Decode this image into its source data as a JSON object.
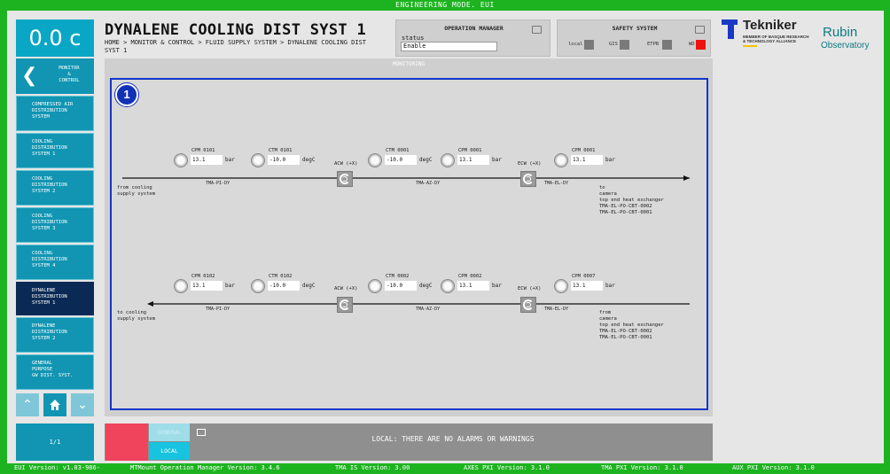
{
  "window": {
    "mode_title": "ENGINEERING MODE. EUI"
  },
  "sidebar": {
    "temperature": "0.0 c",
    "back": {
      "label": "MONITOR\n&\nCONTROL"
    },
    "items": [
      {
        "label": "COMPRESSED AIR\nDISTRIBUTION\nSYSTEM",
        "active": false
      },
      {
        "label": "COOLING\nDISTRIBUTION\nSYSTEM 1",
        "active": false
      },
      {
        "label": "COOLING\nDISTRIBUTION\nSYSTEM 2",
        "active": false
      },
      {
        "label": "COOLING\nDISTRIBUTION\nSYSTEM 3",
        "active": false
      },
      {
        "label": "COOLING\nDISTRIBUTION\nSYSTEM 4",
        "active": false
      },
      {
        "label": "DYNALENE\nDISTRIBUTION\nSYSTEM 1",
        "active": true
      },
      {
        "label": "DYNALENE\nDISTRIBUTION\nSYSTEM 2",
        "active": false
      },
      {
        "label": "GENERAL\nPURPOSE\nGW DIST. SYST.",
        "active": false
      }
    ],
    "pager": "1/1"
  },
  "header": {
    "title": "DYNALENE COOLING DIST SYST 1",
    "breadcrumb": "HOME > MONITOR & CONTROL > FLUID SUPPLY SYSTEM > DYNALENE COOLING DIST SYST 1"
  },
  "operation_manager": {
    "title": "OPERATION MANAGER",
    "status_label": "status",
    "status_value": "Enable"
  },
  "safety_system": {
    "title": "SAFETY SYSTEM",
    "items": [
      {
        "label": "local",
        "color": "#7a7a7a"
      },
      {
        "label": "GIS",
        "color": "#7a7a7a"
      },
      {
        "label": "ETPB",
        "color": "#7a7a7a"
      },
      {
        "label": "WD",
        "color": "#ee1111"
      }
    ]
  },
  "logos": {
    "tekniker": {
      "name": "Tekniker",
      "sub": "MEMBER OF BASQUE RESEARCH\n& TECHNOLOGY ALLIANCE"
    },
    "rubin": {
      "line1": "Rubin",
      "line2": "Observatory"
    }
  },
  "monitoring": {
    "title": "MONITORING",
    "badge": "1",
    "line1": {
      "gauges": [
        {
          "label": "CPM 0101",
          "value": "13.1",
          "unit": "bar"
        },
        {
          "label": "CTM 0101",
          "value": "-10.0",
          "unit": "degC"
        },
        {
          "label": "CTM 0001",
          "value": "-10.0",
          "unit": "degC"
        },
        {
          "label": "CPM 0001",
          "value": "13.1",
          "unit": "bar"
        },
        {
          "label": "CPM 0001",
          "value": "13.1",
          "unit": "bar"
        }
      ],
      "fans": [
        "ACW (+X)",
        "ECW (+X)"
      ],
      "tags": [
        "TMA-PI-DY",
        "TMA-AZ-DY",
        "TMA-EL-DY"
      ],
      "from_note": "from cooling\nsupply system",
      "to_note": "to\ncamera\ntop end heat exchanger\nTMA-EL-PO-CBT-0002\nTMA-EL-PO-CBT-0001"
    },
    "line2": {
      "gauges": [
        {
          "label": "CPM 0102",
          "value": "13.1",
          "unit": "bar"
        },
        {
          "label": "CTM 0102",
          "value": "-10.0",
          "unit": "degC"
        },
        {
          "label": "CTM 0002",
          "value": "-10.0",
          "unit": "degC"
        },
        {
          "label": "CPM 0002",
          "value": "13.1",
          "unit": "bar"
        },
        {
          "label": "CPM 0007",
          "value": "13.1",
          "unit": "bar"
        }
      ],
      "fans": [
        "ACW (+X)",
        "ECW (+X)"
      ],
      "tags": [
        "TMA-PI-DY",
        "TMA-AZ-DY",
        "TMA-EL-DY"
      ],
      "to_note": "to cooling\nsupply system",
      "from_note": "from\ncamera\ntop end heat exchanger\nTMA-EL-PO-CBT-0002\nTMA-EL-PO-CBT-0001"
    }
  },
  "alarm_bar": {
    "tab_general": "GENERAL",
    "tab_local": "LOCAL",
    "message": "LOCAL: THERE ARE NO ALARMS OR WARNINGS"
  },
  "footer": {
    "eui_version": "EUI Version: v1.03-986-",
    "mtmount_version": "MTMount Operation Manager Version: 3.4.6",
    "tma_is_version": "TMA IS Version: 3.00",
    "axes_pxi_version": "AXES PXI Version: 3.1.0",
    "tma_pxi_version": "TMA PXI Version: 3.1.0",
    "aux_pxi_version": "AUX PXI Version: 3.1.0"
  }
}
